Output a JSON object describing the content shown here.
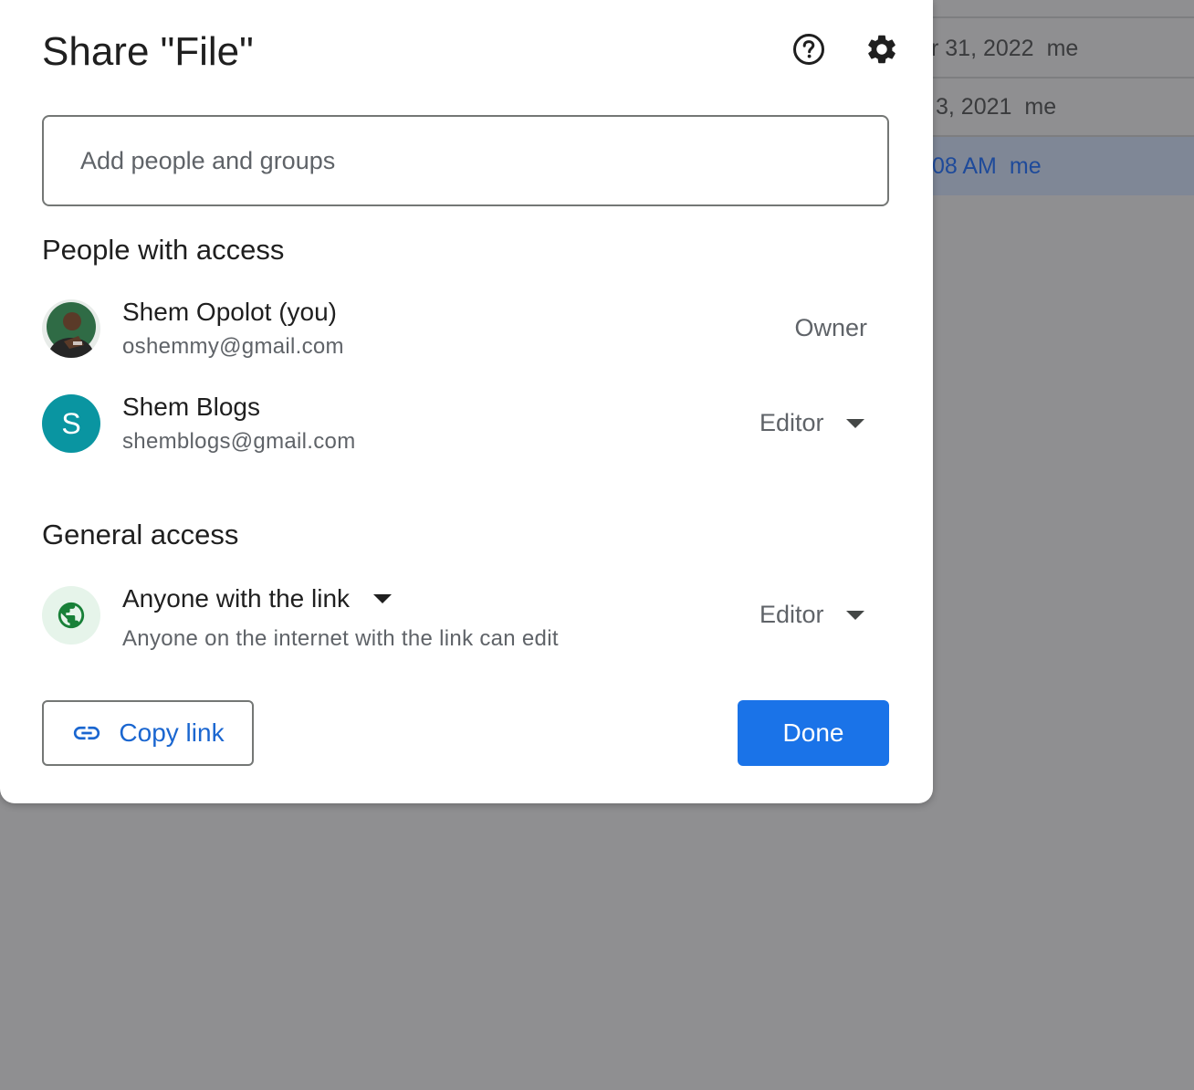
{
  "background_list": {
    "rows": [
      {
        "date": "",
        "owner": ""
      },
      {
        "date": "r 31, 2022",
        "owner": "me"
      },
      {
        "date": "3, 2021",
        "owner": "me"
      },
      {
        "date": "08 AM",
        "owner": "me"
      }
    ]
  },
  "dialog": {
    "title": "Share \"File\"",
    "help_icon": "help-circle-icon",
    "settings_icon": "gear-icon",
    "add_people": {
      "placeholder": "Add people and groups",
      "value": ""
    },
    "people_section_title": "People with access",
    "people": [
      {
        "name": "Shem Opolot (you)",
        "email": "oshemmy@gmail.com",
        "role": "Owner",
        "avatar": "photo"
      },
      {
        "name": "Shem Blogs",
        "email": "shemblogs@gmail.com",
        "role": "Editor",
        "avatar_letter": "S",
        "avatar_color": "#0a95a1"
      }
    ],
    "general_section_title": "General access",
    "general_access": {
      "scope": "Anyone with the link",
      "description": "Anyone on the internet with the link can edit",
      "role": "Editor",
      "icon": "globe-icon"
    },
    "copy_link_label": "Copy link",
    "done_label": "Done"
  },
  "colors": {
    "accent": "#1a73e8",
    "link_text": "#1a66d0",
    "overlay": "#8f8f91",
    "globe_bg": "#e6f4ea",
    "globe": "#188038"
  }
}
